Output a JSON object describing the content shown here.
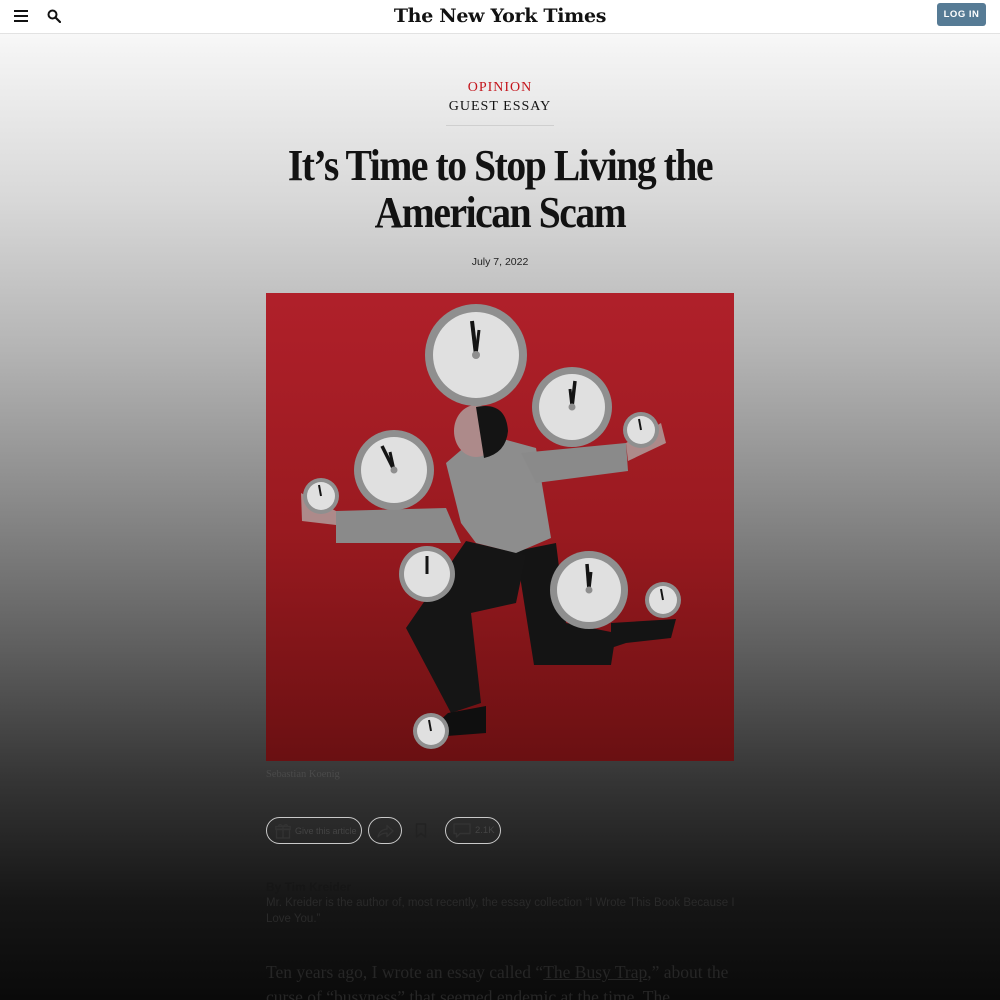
{
  "header": {
    "logo": "The New York Times",
    "login_label": "LOG IN",
    "icons": {
      "menu": "hamburger-menu-icon",
      "search": "search-icon"
    }
  },
  "article": {
    "kicker": "OPINION",
    "subkicker": "GUEST ESSAY",
    "headline": "It’s Time to Stop Living the American Scam",
    "date": "July 7, 2022",
    "image_credit": "Sebastian Koenig",
    "byline": "By Tim Kreider",
    "bio": "Mr. Kreider is the author of, most recently, the essay collection “I Wrote This Book Because I Love You.”",
    "body": {
      "lead_before": "Ten years ago, I wrote an essay called “",
      "link": "The Busy Trap",
      "lead_after": ",” about the curse of “busyness” that seemed endemic at the time. The"
    }
  },
  "actions": {
    "gift_label": "Give this article",
    "comment_count": "2.1K",
    "icons": {
      "gift": "gift-icon",
      "share": "share-icon",
      "save": "bookmark-icon",
      "comments": "comment-icon"
    }
  },
  "colors": {
    "accent_red": "#c4151c",
    "login_blue": "#567b95",
    "illustration_red": "#b0202a"
  }
}
